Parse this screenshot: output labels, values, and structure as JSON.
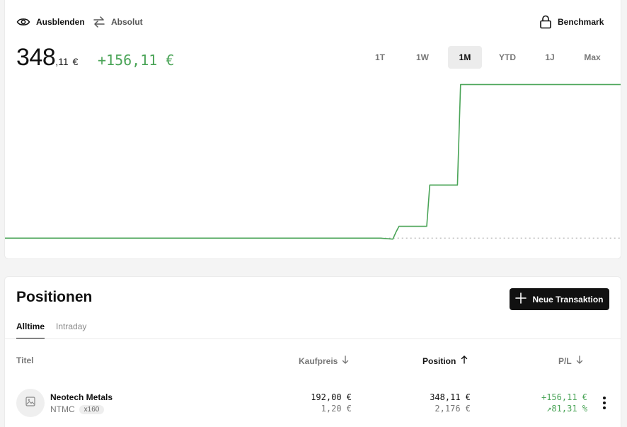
{
  "toolbar": {
    "hide_label": "Ausblenden",
    "absolute_label": "Absolut",
    "benchmark_label": "Benchmark"
  },
  "portfolio": {
    "value_int": "348",
    "value_dec": ",11",
    "currency": "€",
    "change": "+156,11 €"
  },
  "ranges": [
    {
      "label": "1T",
      "active": false
    },
    {
      "label": "1W",
      "active": false
    },
    {
      "label": "1M",
      "active": true
    },
    {
      "label": "YTD",
      "active": false
    },
    {
      "label": "1J",
      "active": false
    },
    {
      "label": "Max",
      "active": false
    }
  ],
  "colors": {
    "positive": "#4aa457",
    "accent_dark": "#111111"
  },
  "chart_data": {
    "type": "line",
    "x": [
      0,
      0.61,
      0.63,
      0.635,
      0.64,
      0.685,
      0.69,
      0.735,
      0.74,
      1.0
    ],
    "series": [
      {
        "values": [
          192.0,
          192.0,
          191.0,
          198.0,
          204.0,
          204.0,
          246.0,
          246.0,
          348.11,
          348.11
        ]
      }
    ],
    "baseline": 192.0,
    "ylim": [
      185,
      352
    ],
    "grid": false
  },
  "positions": {
    "title": "Positionen",
    "new_transaction_label": "Neue Transaktion",
    "tabs": [
      {
        "label": "Alltime",
        "active": true
      },
      {
        "label": "Intraday",
        "active": false
      }
    ],
    "columns": {
      "title": "Titel",
      "purchase": "Kaufpreis",
      "position": "Position",
      "pl": "P/L"
    },
    "rows": [
      {
        "name": "Neotech Metals",
        "ticker": "NTMC",
        "quantity": "x160",
        "purchase_total": "192,00 €",
        "purchase_unit": "1,20 €",
        "position_total": "348,11 €",
        "position_unit": "2,176 €",
        "pl_abs": "+156,11 €",
        "pl_pct": "↗81,31 %"
      }
    ]
  }
}
